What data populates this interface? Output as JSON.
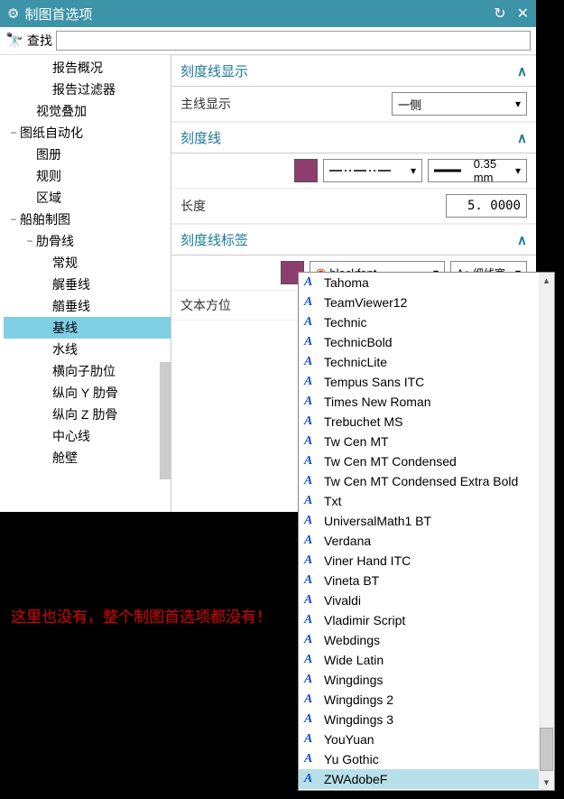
{
  "titlebar": {
    "title": "制图首选项"
  },
  "search": {
    "label": "查找",
    "value": ""
  },
  "tree": [
    {
      "d": 3,
      "t": "报告概况"
    },
    {
      "d": 3,
      "t": "报告过滤器"
    },
    {
      "d": 2,
      "t": "视觉叠加"
    },
    {
      "d": 1,
      "t": "图纸自动化",
      "exp": "−"
    },
    {
      "d": 2,
      "t": "图册"
    },
    {
      "d": 2,
      "t": "规则"
    },
    {
      "d": 2,
      "t": "区域"
    },
    {
      "d": 1,
      "t": "船舶制图",
      "exp": "−"
    },
    {
      "d": 2,
      "t": "肋骨线",
      "exp": "−"
    },
    {
      "d": 3,
      "t": "常规"
    },
    {
      "d": 3,
      "t": "艉垂线"
    },
    {
      "d": 3,
      "t": "艏垂线"
    },
    {
      "d": 3,
      "t": "基线",
      "sel": true
    },
    {
      "d": 3,
      "t": "水线"
    },
    {
      "d": 3,
      "t": "横向子肋位"
    },
    {
      "d": 3,
      "t": "纵向 Y 肋骨"
    },
    {
      "d": 3,
      "t": "纵向 Z 肋骨"
    },
    {
      "d": 3,
      "t": "中心线"
    },
    {
      "d": 3,
      "t": "舱壁"
    }
  ],
  "sections": {
    "tick_display": {
      "title": "刻度线显示",
      "mainline_label": "主线显示",
      "mainline_value": "一侧"
    },
    "tick": {
      "title": "刻度线",
      "weight_label": "0.35 mm",
      "length_label": "长度",
      "length_value": "5. 0000"
    },
    "tick_label": {
      "title": "刻度线标签",
      "font_value": "blockfont",
      "style_value": "细线宽",
      "style_prefix": "Aa",
      "textdir_label": "文本方位"
    }
  },
  "fonts": [
    "Tahoma",
    "TeamViewer12",
    "Technic",
    "TechnicBold",
    "TechnicLite",
    "Tempus Sans ITC",
    "Times New Roman",
    "Trebuchet MS",
    "Tw Cen MT",
    "Tw Cen MT Condensed",
    "Tw Cen MT Condensed Extra Bold",
    "Txt",
    "UniversalMath1 BT",
    "Verdana",
    "Viner Hand ITC",
    "Vineta BT",
    "Vivaldi",
    "Vladimir Script",
    "Webdings",
    "Wide Latin",
    "Wingdings",
    "Wingdings 2",
    "Wingdings 3",
    "YouYuan",
    "Yu Gothic",
    "ZWAdobeF"
  ],
  "font_selected": "ZWAdobeF",
  "message": "这里也没有，整个制图首选项都没有！"
}
